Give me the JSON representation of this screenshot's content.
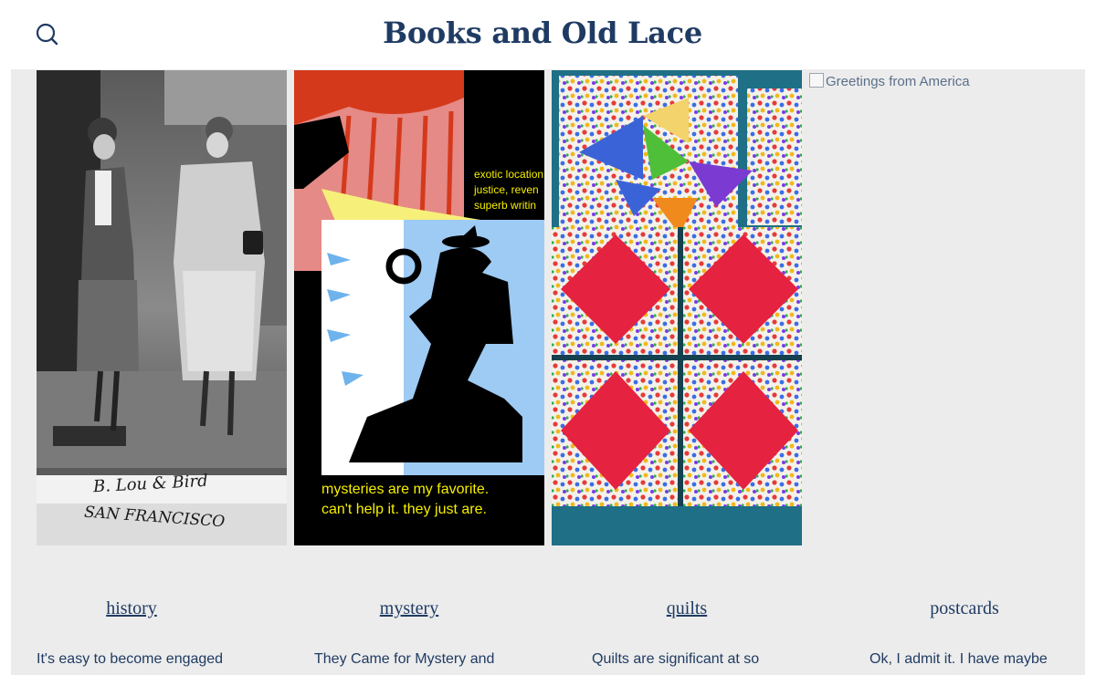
{
  "site": {
    "title": "Books and Old Lace"
  },
  "header": {
    "search_icon": "search-icon"
  },
  "gallery": {
    "history_photo": {
      "caption_line1": "B. Lou & Bird",
      "caption_line2": "SAN FRANCISCO"
    },
    "mystery_poster": {
      "tagline": [
        "exotic location",
        "justice, reven",
        "superb writin"
      ],
      "footer": [
        "mysteries are my favorite.",
        "can't help it. they just are."
      ]
    },
    "postcard_alt": "Greetings from America"
  },
  "categories": [
    {
      "title": "history",
      "excerpt": "It's easy to become engaged"
    },
    {
      "title": "mystery",
      "excerpt": "They Came for Mystery and"
    },
    {
      "title": "quilts",
      "excerpt": "Quilts are significant at so"
    },
    {
      "title": "postcards",
      "excerpt": "Ok, I admit it. I have maybe"
    }
  ],
  "colors": {
    "brand": "#1f3b63",
    "band": "#ececec"
  }
}
